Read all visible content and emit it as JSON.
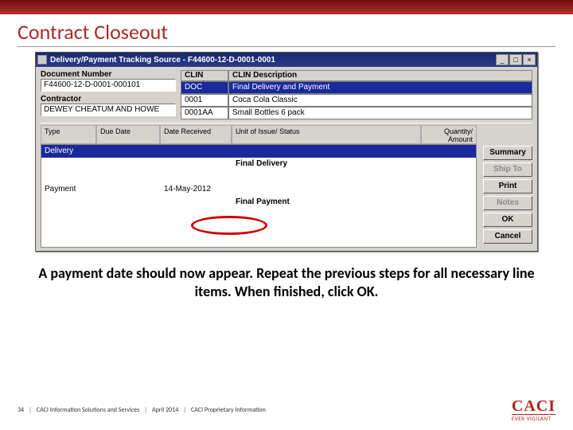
{
  "slide": {
    "title": "Contract Closeout",
    "caption": "A payment date should now appear.  Repeat the previous steps for all necessary line items.  When finished, click OK."
  },
  "window": {
    "title": "Delivery/Payment Tracking Source - F44600-12-D-0001-0001",
    "min": "_",
    "max": "□",
    "close": "×"
  },
  "doc": {
    "label_num": "Document Number",
    "num": "F44600-12-D-0001-000101",
    "label_contractor": "Contractor",
    "contractor": "DEWEY CHEATUM AND HOWE"
  },
  "clin": {
    "hdr_num": "CLIN Number",
    "hdr_desc": "CLIN Description",
    "rows": [
      {
        "num": "DOC",
        "desc": "Final Delivery and Payment",
        "sel": true
      },
      {
        "num": "0001",
        "desc": "Coca Cola Classic",
        "sel": false
      },
      {
        "num": "0001AA",
        "desc": "Small Bottles 6 pack",
        "sel": false
      }
    ]
  },
  "grid": {
    "h1": "Type",
    "h2": "Due Date",
    "h3": "Date Received",
    "h4": "Unit of Issue/ Status",
    "h5": "Quantity/ Amount",
    "rows": [
      {
        "c1": "Delivery",
        "c2": "",
        "c3": "",
        "c4": "",
        "c5": "",
        "sel": true
      },
      {
        "c1": "",
        "c2": "",
        "c3": "",
        "c4": "Final Delivery",
        "c5": "",
        "bold": true
      },
      {
        "c1": " ",
        "c2": "",
        "c3": "",
        "c4": "",
        "c5": ""
      },
      {
        "c1": "Payment",
        "c2": "",
        "c3": "14-May-2012",
        "c4": "",
        "c5": ""
      },
      {
        "c1": "",
        "c2": "",
        "c3": "",
        "c4": "Final Payment",
        "c5": "",
        "bold": true
      }
    ]
  },
  "buttons": {
    "summary": "Summary",
    "shipto": "Ship To",
    "print": "Print",
    "notes": "Notes",
    "ok": "OK",
    "cancel": "Cancel"
  },
  "footer": {
    "page": "34",
    "sep": "|",
    "org": "CACI Information Solutions and Services",
    "date": "April 2014",
    "prop": "CACI Proprietary Information",
    "logo": "CACI",
    "tagline": "EVER VIGILANT"
  }
}
